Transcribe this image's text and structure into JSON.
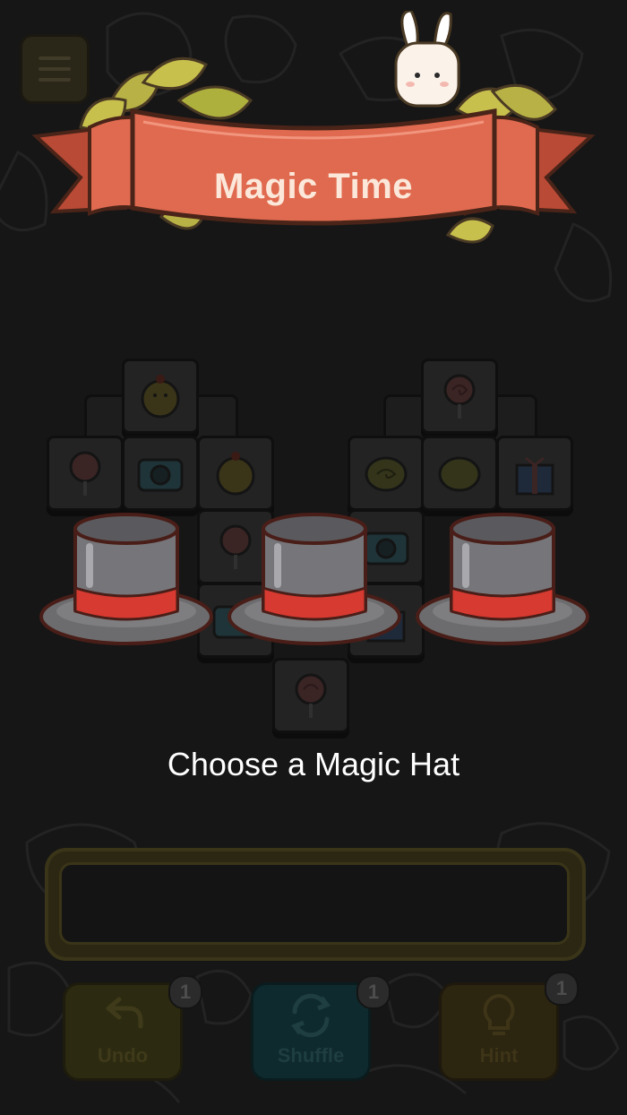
{
  "banner": {
    "title": "Magic Time"
  },
  "prompt": "Choose a Magic Hat",
  "hats": [
    {
      "label": "hat-1"
    },
    {
      "label": "hat-2"
    },
    {
      "label": "hat-3"
    }
  ],
  "powerups": [
    {
      "name": "undo",
      "label": "Undo",
      "count": "1",
      "color": "#2c2a10",
      "icon": "undo-arrow-icon"
    },
    {
      "name": "shuffle",
      "label": "Shuffle",
      "count": "1",
      "color": "#0f2a2e",
      "icon": "shuffle-icon"
    },
    {
      "name": "hint",
      "label": "Hint",
      "count": "1",
      "color": "#2c2510",
      "icon": "lightbulb-icon"
    }
  ],
  "tiles": [
    "chick",
    "lollipop",
    "camera",
    "swiss-roll",
    "gift",
    "chick",
    "lollipop",
    "camera",
    "swiss-roll",
    "gift",
    "lollipop",
    "camera",
    "lollipop"
  ],
  "colors": {
    "ribbon": "#e06a4f",
    "ribbon_dark": "#b94a36",
    "leaf": "#c8c04c",
    "hat_gray": "#7a7a7c",
    "hat_band": "#d63a30"
  }
}
